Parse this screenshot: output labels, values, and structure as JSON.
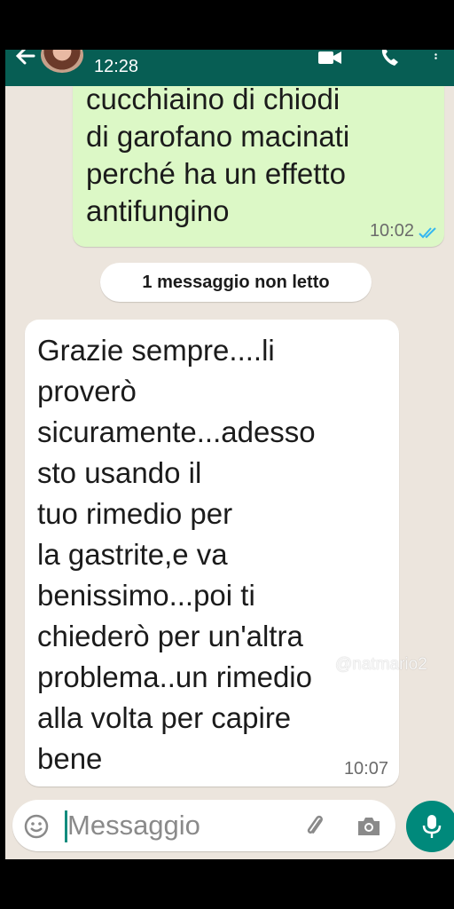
{
  "header": {
    "time": "12:28"
  },
  "messages": [
    {
      "direction": "outgoing",
      "text": "cucchiaino di chiodi\ndi garofano macinati\nperché ha un effetto\nantifungino",
      "time": "10:02",
      "status": "read"
    },
    {
      "direction": "incoming",
      "text": "Grazie sempre....li\nproverò\nsicuramente...adesso\nsto usando il\ntuo rimedio per\nla gastrite,e va\nbenissimo...poi ti\nchiederò per un'altra\nproblema..un rimedio\nalla volta per capire\nbene",
      "time": "10:07"
    }
  ],
  "unread_notice": "1 messaggio non letto",
  "watermark": "@natmario2",
  "input": {
    "placeholder": "Messaggio",
    "value": ""
  },
  "icons": {
    "back": "arrow-left-icon",
    "video": "video-camera-icon",
    "call": "phone-icon",
    "menu": "more-vertical-icon",
    "emoji": "smiley-icon",
    "attach": "paperclip-icon",
    "camera": "camera-icon",
    "mic": "microphone-icon",
    "read_receipt": "double-check-icon"
  },
  "colors": {
    "header": "#075e54",
    "outgoing_bubble": "#dcf8c6",
    "incoming_bubble": "#ffffff",
    "chat_background": "#ece5dd",
    "read_ticks": "#34b7f1",
    "mic_button": "#00897b"
  }
}
